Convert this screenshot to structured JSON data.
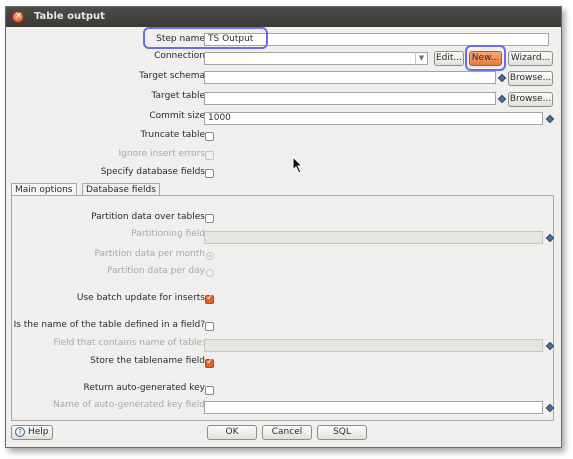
{
  "window": {
    "title": "Table output"
  },
  "step_name": {
    "label": "Step name",
    "value": "TS Output"
  },
  "connection": {
    "label": "Connection",
    "value": "",
    "edit": "Edit...",
    "new": "New...",
    "wizard": "Wizard..."
  },
  "target_schema": {
    "label": "Target schema",
    "value": "",
    "browse": "Browse..."
  },
  "target_table": {
    "label": "Target table",
    "value": "",
    "browse": "Browse..."
  },
  "commit_size": {
    "label": "Commit size",
    "value": "1000"
  },
  "truncate_table": {
    "label": "Truncate table",
    "checked": false
  },
  "ignore_insert_errors": {
    "label": "Ignore insert errors",
    "checked": false
  },
  "specify_database_fields": {
    "label": "Specify database fields",
    "checked": false
  },
  "tabs": [
    {
      "label": "Main options"
    },
    {
      "label": "Database fields"
    }
  ],
  "main_options": {
    "partition_over_tables": {
      "label": "Partition data over tables",
      "checked": false
    },
    "partitioning_field": {
      "label": "Partitioning field",
      "value": ""
    },
    "partition_per_month": {
      "label": "Partition data per month",
      "selected": true
    },
    "partition_per_day": {
      "label": "Partition data per day",
      "selected": false
    },
    "batch_update": {
      "label": "Use batch update for inserts",
      "checked": true
    },
    "table_name_in_field": {
      "label": "Is the name of the table defined in a field?",
      "checked": false
    },
    "table_name_field": {
      "label": "Field that contains name of table:",
      "value": ""
    },
    "store_tablename_field": {
      "label": "Store the tablename field",
      "checked": true
    },
    "return_generated_key": {
      "label": "Return auto-generated key",
      "checked": false
    },
    "generated_key_field": {
      "label": "Name of auto-generated key field",
      "value": ""
    }
  },
  "footer": {
    "help": "Help",
    "ok": "OK",
    "cancel": "Cancel",
    "sql": "SQL"
  },
  "colors": {
    "highlight": "#6b6de0",
    "new_button": "#f08a4b",
    "checked": "#e0632d"
  }
}
